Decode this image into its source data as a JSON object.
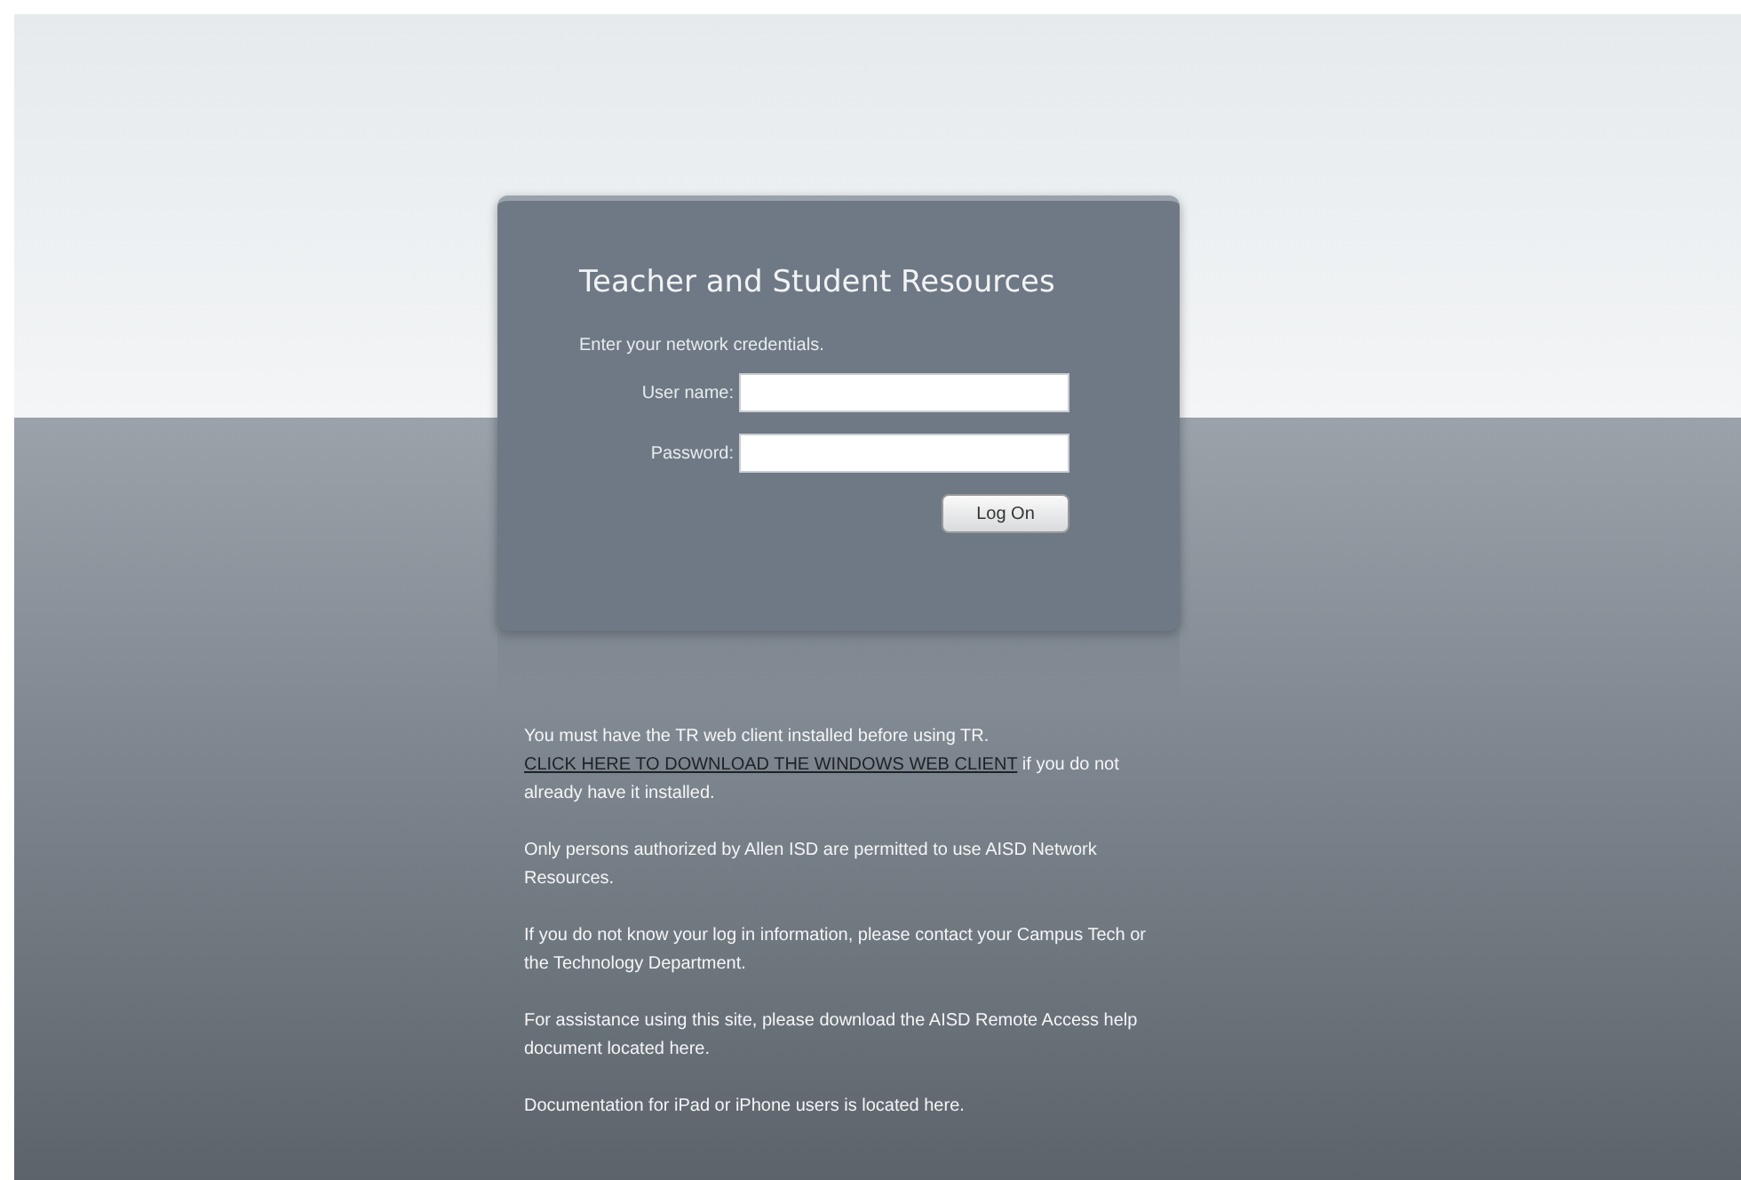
{
  "login": {
    "title": "Teacher and Student Resources",
    "prompt": "Enter your network credentials.",
    "fields": [
      {
        "label": "User name:"
      },
      {
        "label": "Password:"
      }
    ],
    "button": "Log On"
  },
  "notes": [
    {
      "kind": "link_text",
      "before": "You must have the TR web client installed before using TR.",
      "link": "CLICK HERE TO DOWNLOAD THE WINDOWS WEB CLIENT",
      "after": "if you do not already have it installed."
    },
    {
      "kind": "plain",
      "text": "Only persons authorized by Allen ISD are permitted to use AISD Network Resources."
    },
    {
      "kind": "plain",
      "text": "If you do not know your log in information, please contact your Campus Tech or the Technology Department."
    },
    {
      "kind": "plain",
      "text": "For assistance using this site, please download the AISD Remote Access help document located here."
    },
    {
      "kind": "plain",
      "text": "Documentation for iPad or iPhone users is located here."
    }
  ]
}
